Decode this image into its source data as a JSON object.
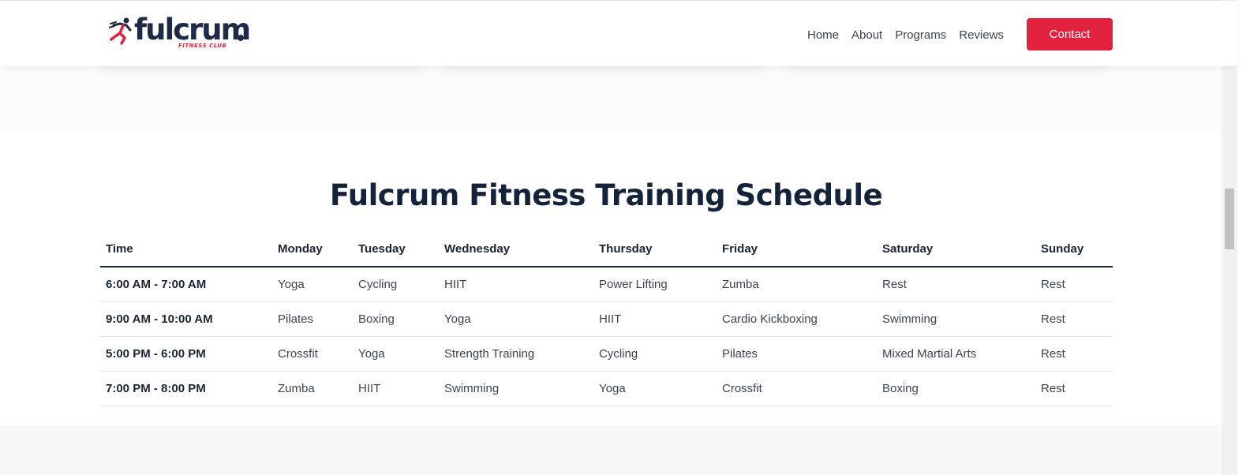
{
  "header": {
    "logo_text": "fulcrum",
    "logo_subtext": "FITNESS CLUB",
    "nav": [
      "Home",
      "About",
      "Programs",
      "Reviews"
    ],
    "contact_label": "Contact"
  },
  "colors": {
    "brand_red": "#e0223f",
    "brand_navy": "#1f2a47"
  },
  "schedule": {
    "title": "Fulcrum Fitness Training Schedule",
    "columns": [
      "Time",
      "Monday",
      "Tuesday",
      "Wednesday",
      "Thursday",
      "Friday",
      "Saturday",
      "Sunday"
    ],
    "rows": [
      [
        "6:00 AM - 7:00 AM",
        "Yoga",
        "Cycling",
        "HIIT",
        "Power Lifting",
        "Zumba",
        "Rest",
        "Rest"
      ],
      [
        "9:00 AM - 10:00 AM",
        "Pilates",
        "Boxing",
        "Yoga",
        "HIIT",
        "Cardio Kickboxing",
        "Swimming",
        "Rest"
      ],
      [
        "5:00 PM - 6:00 PM",
        "Crossfit",
        "Yoga",
        "Strength Training",
        "Cycling",
        "Pilates",
        "Mixed Martial Arts",
        "Rest"
      ],
      [
        "7:00 PM - 8:00 PM",
        "Zumba",
        "HIIT",
        "Swimming",
        "Yoga",
        "Crossfit",
        "Boxing",
        "Rest"
      ]
    ]
  }
}
